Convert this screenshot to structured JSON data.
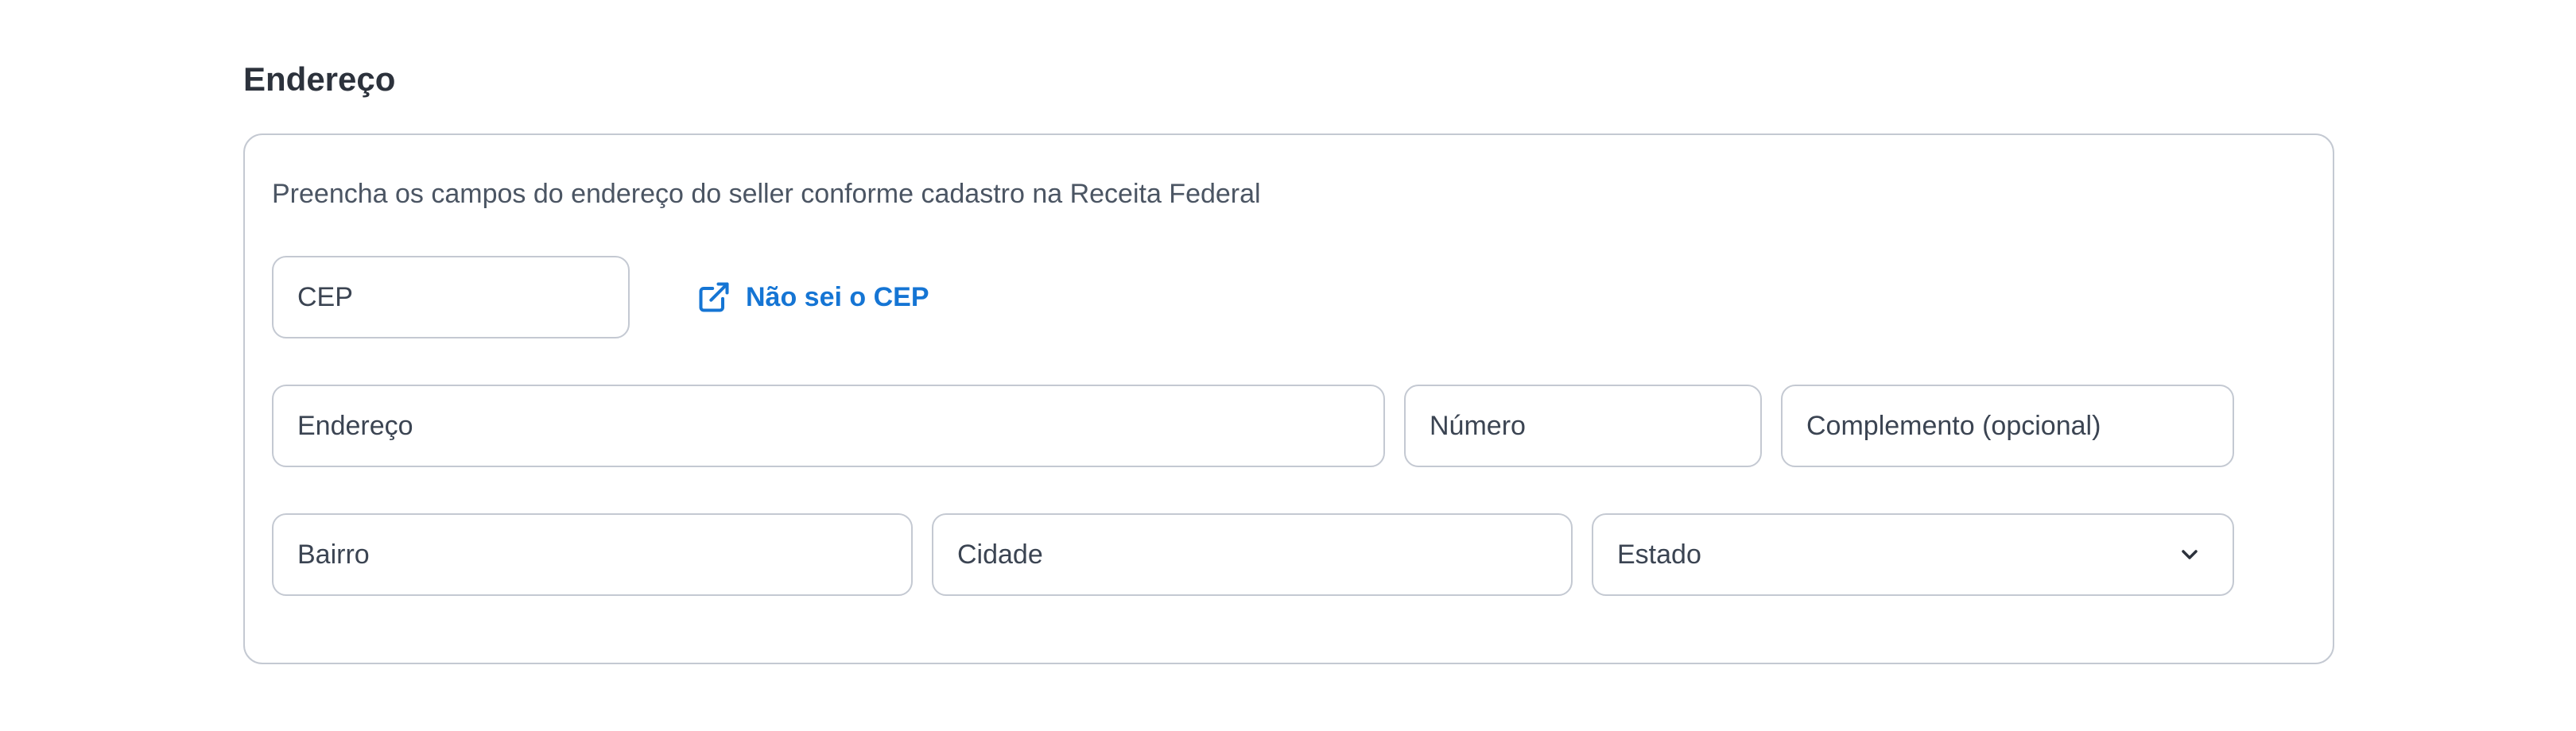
{
  "section": {
    "title": "Endereço",
    "description": "Preencha os campos do endereço do seller conforme cadastro na Receita Federal"
  },
  "fields": {
    "cep": {
      "placeholder": "CEP",
      "value": ""
    },
    "endereco": {
      "placeholder": "Endereço",
      "value": ""
    },
    "numero": {
      "placeholder": "Número",
      "value": ""
    },
    "complemento": {
      "placeholder": "Complemento (opcional)",
      "value": ""
    },
    "bairro": {
      "placeholder": "Bairro",
      "value": ""
    },
    "cidade": {
      "placeholder": "Cidade",
      "value": ""
    },
    "estado": {
      "label": "Estado"
    }
  },
  "links": {
    "cep_lookup": {
      "label": "Não sei o CEP",
      "icon": "external-link-icon"
    }
  },
  "icons": {
    "estado_dropdown": "chevron-down-icon"
  },
  "colors": {
    "link": "#1575d4",
    "border": "#c4c9d2",
    "title": "#2c323c",
    "text": "#3b4452"
  }
}
